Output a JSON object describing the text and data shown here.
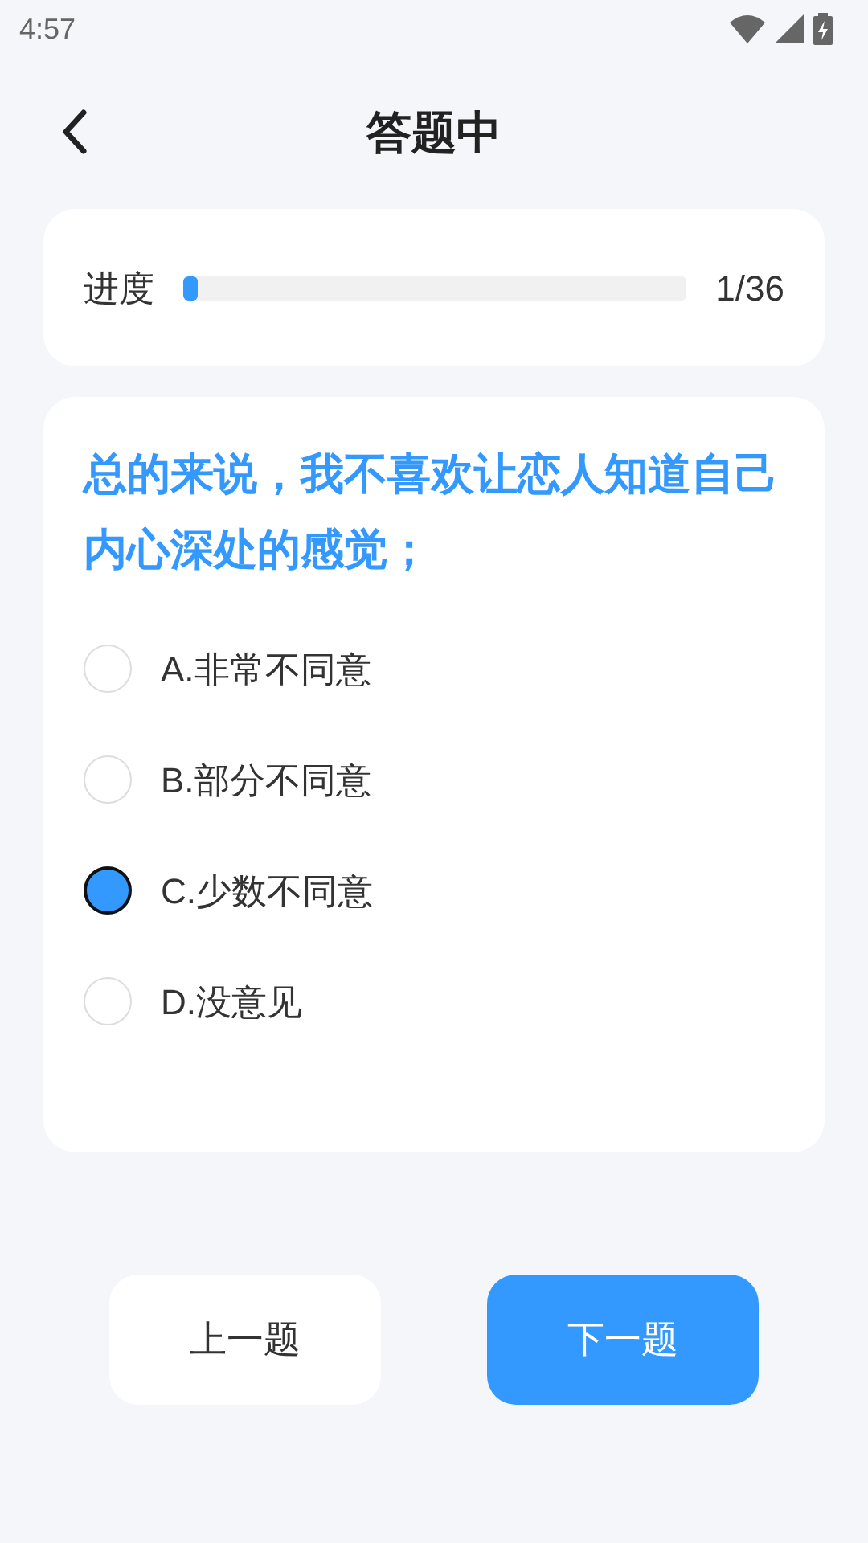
{
  "status_bar": {
    "time": "4:57"
  },
  "header": {
    "title": "答题中"
  },
  "progress": {
    "label": "进度",
    "level": 0.028,
    "count": "1/36"
  },
  "question": {
    "text": "总的来说，我不喜欢让恋人知道自己内心深处的感觉；",
    "options": [
      {
        "label": "A.非常不同意",
        "selected": false
      },
      {
        "label": "B.部分不同意",
        "selected": false
      },
      {
        "label": "C.少数不同意",
        "selected": true
      },
      {
        "label": "D.没意见",
        "selected": false
      }
    ]
  },
  "buttons": [
    {
      "label": "上一题",
      "kind": "secondary"
    },
    {
      "label": "下一题",
      "kind": "primary"
    }
  ]
}
